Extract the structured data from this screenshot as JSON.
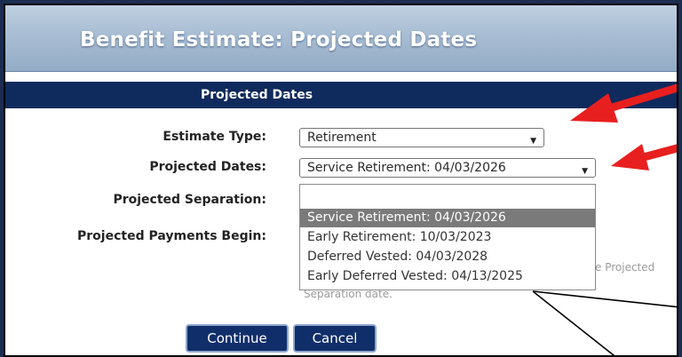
{
  "page": {
    "title": "Benefit Estimate: Projected Dates"
  },
  "section": {
    "title": "Projected Dates"
  },
  "form": {
    "estimate_type": {
      "label": "Estimate Type:",
      "value": "Retirement"
    },
    "projected_dates": {
      "label": "Projected Dates:",
      "value": "Service Retirement: 04/03/2026"
    },
    "projected_separation": {
      "label": "Projected Separation:"
    },
    "projected_payments_begin": {
      "label": "Projected Payments Begin:"
    }
  },
  "dropdown": {
    "options": [
      "",
      "Service Retirement: 04/03/2026",
      "Early Retirement: 10/03/2023",
      "Deferred Vested: 04/03/2028",
      "Early Deferred Vested: 04/13/2025"
    ],
    "selected_index": 1
  },
  "help_text": {
    "fragment_right": "e Projected",
    "fragment_bottom": "Separation date."
  },
  "buttons": {
    "continue": "Continue",
    "cancel": "Cancel"
  },
  "colors": {
    "header_bar": "#0f2a5c",
    "button": "#102f6a",
    "annotation_arrow": "#e81f1f",
    "selected_option": "#7a7a7a"
  }
}
